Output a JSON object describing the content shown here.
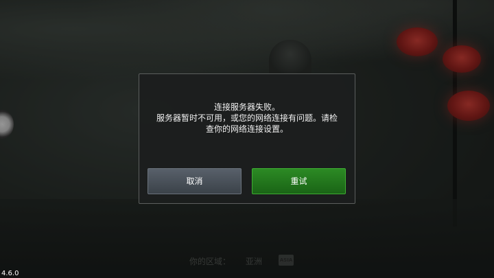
{
  "dialog": {
    "message_lines": [
      "连接服务器失败。",
      "服务器暂时不可用，或您的网络连接有问题。请检",
      "查你的网络连接设置。"
    ],
    "cancel_label": "取消",
    "retry_label": "重试"
  },
  "background": {
    "region_label": "你的区域：",
    "region_value": "亚洲",
    "region_badge": "ASIA"
  },
  "version": "4.6.0",
  "colors": {
    "retry_button": "#1f7a1a",
    "cancel_button": "#4a525b",
    "dialog_bg": "#1c1e1e"
  }
}
